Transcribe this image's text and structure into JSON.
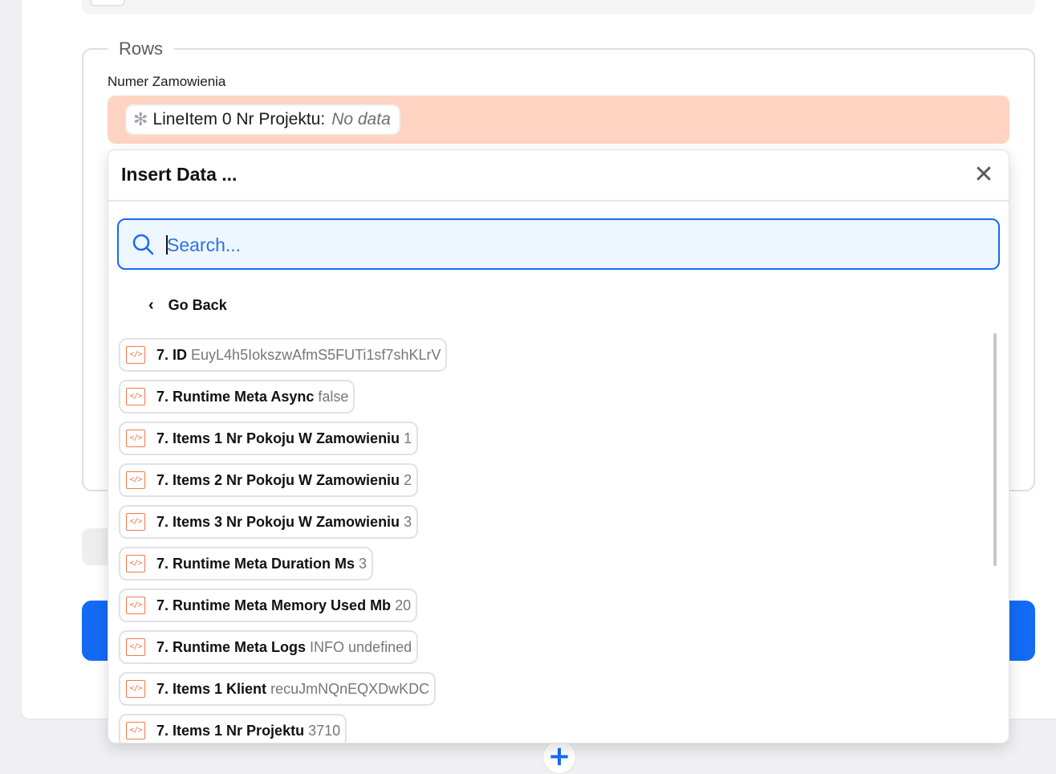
{
  "rows_section": {
    "legend": "Rows",
    "field_label": "Numer Zamowienia",
    "mapped_pill": {
      "icon": "gear-icon",
      "label": "LineItem 0 Nr Projektu:",
      "value": "No data"
    }
  },
  "insert_data": {
    "title": "Insert Data ...",
    "close_icon": "close-icon",
    "search": {
      "placeholder": "Search...",
      "value": ""
    },
    "go_back": "Go Back",
    "items": [
      {
        "label": "7. ID",
        "value": "EuyL4h5IokszwAfmS5FUTi1sf7shKLrV"
      },
      {
        "label": "7. Runtime Meta Async",
        "value": "false"
      },
      {
        "label": "7. Items 1 Nr Pokoju W Zamowieniu",
        "value": "1"
      },
      {
        "label": "7. Items 2 Nr Pokoju W Zamowieniu",
        "value": "2"
      },
      {
        "label": "7. Items 3 Nr Pokoju W Zamowieniu",
        "value": "3"
      },
      {
        "label": "7. Runtime Meta Duration Ms",
        "value": "3"
      },
      {
        "label": "7. Runtime Meta Memory Used Mb",
        "value": "20"
      },
      {
        "label": "7. Runtime Meta Logs",
        "value": "INFO undefined"
      },
      {
        "label": "7. Items 1 Klient",
        "value": "recuJmNQnEQXDwKDC"
      },
      {
        "label": "7. Items 1 Nr Projektu",
        "value": "3710"
      }
    ]
  },
  "colors": {
    "accent": "#136bf5",
    "mapped_field_bg": "#ffd3c2",
    "code_icon": "#f07a4b"
  }
}
